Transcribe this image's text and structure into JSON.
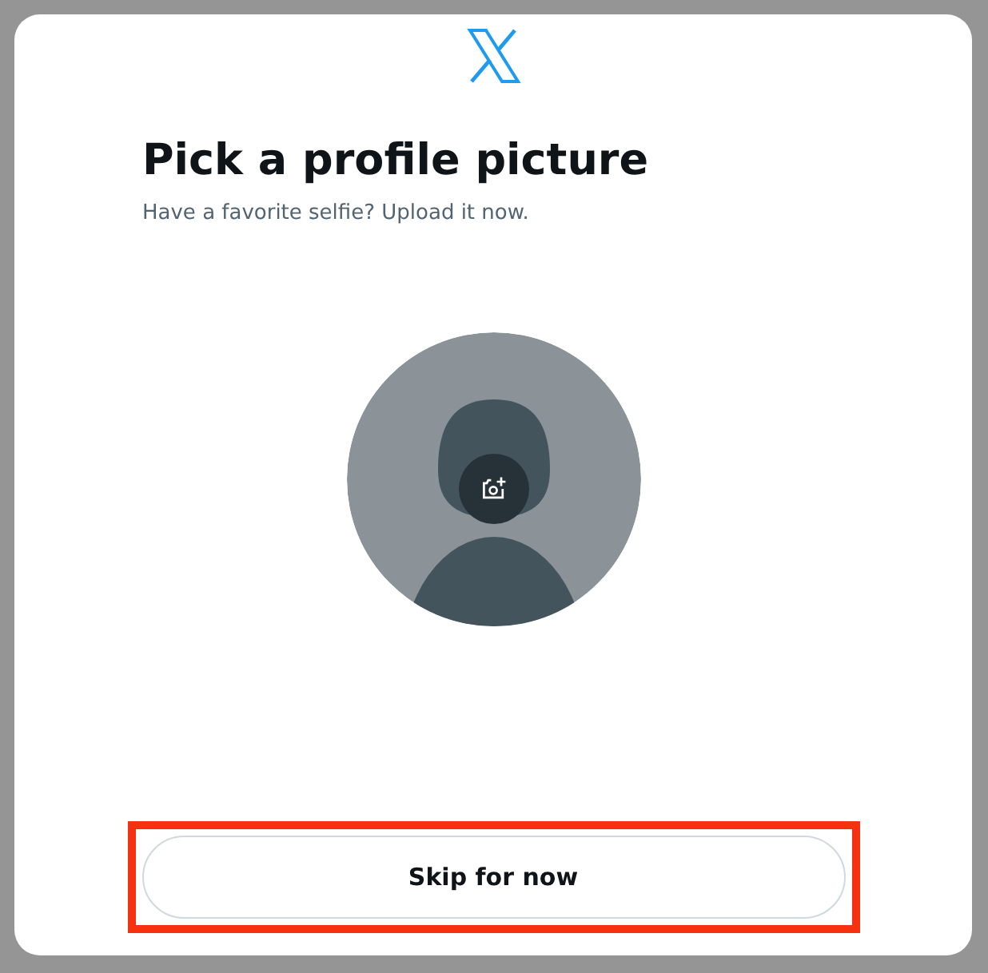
{
  "title": "Pick a profile picture",
  "subtitle": "Have a favorite selfie? Upload it now.",
  "skip_button": {
    "label": "Skip for now",
    "highlighted": true
  }
}
